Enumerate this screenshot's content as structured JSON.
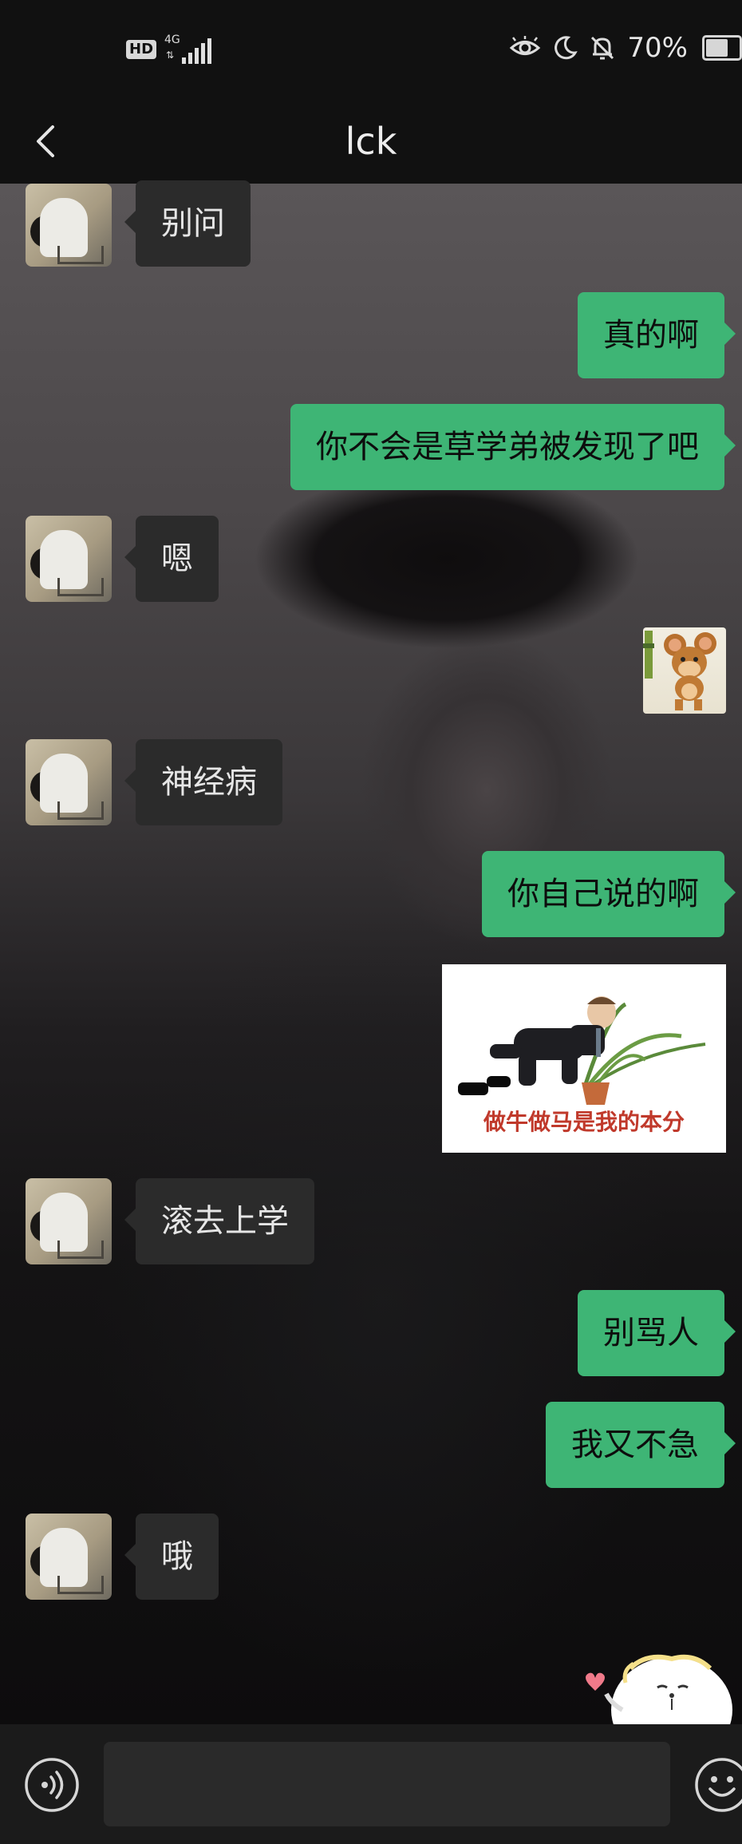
{
  "status_bar": {
    "hd_label": "HD",
    "network_label": "4G",
    "network_arrows": "⇅",
    "battery_percent": "70%",
    "battery_level": 0.7,
    "icons": [
      "eye-comfort-icon",
      "moon-icon",
      "bell-off-icon",
      "battery-icon"
    ]
  },
  "header": {
    "title": "lck",
    "back_icon": "chevron-left-icon"
  },
  "messages": [
    {
      "side": "left",
      "type": "text",
      "text": "别问"
    },
    {
      "side": "right",
      "type": "text",
      "text": "真的啊"
    },
    {
      "side": "right",
      "type": "text",
      "text": "你不会是草学弟被发现了吧"
    },
    {
      "side": "left",
      "type": "text",
      "text": "嗯"
    },
    {
      "side": "right",
      "type": "sticker",
      "sticker": "jerry-mouse-sticker"
    },
    {
      "side": "left",
      "type": "text",
      "text": "神经病"
    },
    {
      "side": "right",
      "type": "text",
      "text": "你自己说的啊"
    },
    {
      "side": "right",
      "type": "sticker",
      "sticker": "meme-sticker",
      "caption": "做牛做马是我的本分"
    },
    {
      "side": "left",
      "type": "text",
      "text": "滚去上学"
    },
    {
      "side": "right",
      "type": "text",
      "text": "别骂人"
    },
    {
      "side": "right",
      "type": "text",
      "text": "我又不急"
    },
    {
      "side": "left",
      "type": "text",
      "text": "哦"
    },
    {
      "side": "right",
      "type": "sticker",
      "sticker": "bunny-heart-sticker"
    }
  ],
  "input_bar": {
    "voice_icon": "voice-icon",
    "emoji_icon": "emoji-icon",
    "input_value": ""
  },
  "colors": {
    "outgoing_bubble": "#3eb575",
    "incoming_bubble": "#2b2b2b",
    "bar_background": "#111111"
  }
}
